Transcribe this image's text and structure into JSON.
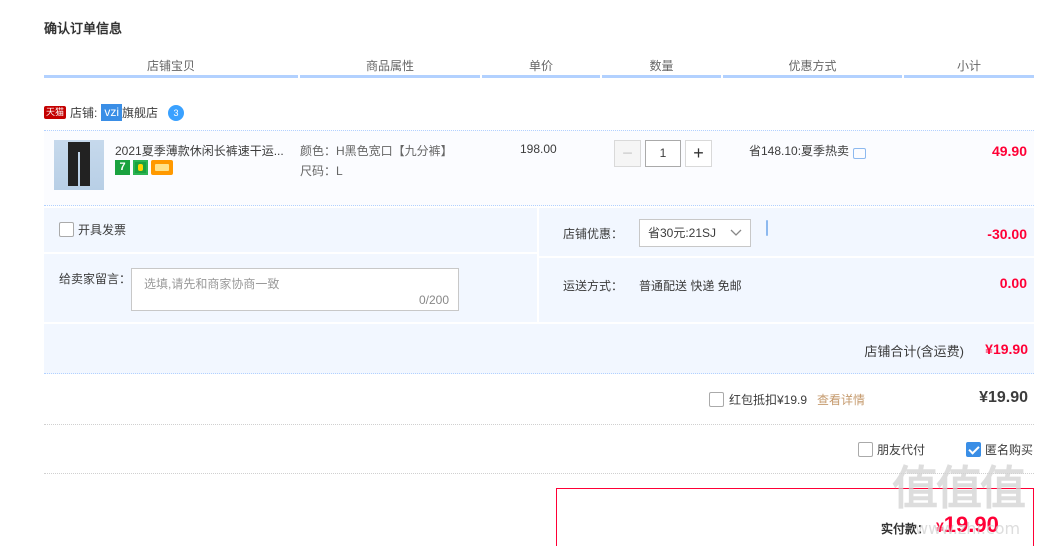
{
  "page": {
    "title": "确认订单信息"
  },
  "columns": [
    "店铺宝贝",
    "商品属性",
    "单价",
    "数量",
    "优惠方式",
    "小计"
  ],
  "shop": {
    "tmall_badge": "天猫",
    "label": "店铺:",
    "name_highlight": "vzi",
    "name_rest": "旗舰店",
    "wangwang": "3"
  },
  "item": {
    "name": "2021夏季薄款休闲长裤速干运...",
    "badge_seven": "7",
    "attr_color": "颜色：H黑色宽口【九分裤】",
    "attr_size": "尺码：L",
    "unit_price": "198.00",
    "quantity": "1",
    "minus": "−",
    "plus": "+",
    "promotion": "省148.10:夏季热卖",
    "subtotal": "49.90"
  },
  "invoice": {
    "label": "开具发票"
  },
  "message": {
    "label": "给卖家留言：",
    "placeholder": "选填,请先和商家协商一致",
    "counter": "0/200"
  },
  "shop_discount": {
    "label": "店铺优惠：",
    "selected": "省30元:21SJ",
    "amount": "-30.00"
  },
  "shipping": {
    "label": "运送方式：",
    "method": "普通配送 快递 免邮",
    "amount": "0.00"
  },
  "shop_total": {
    "label": "店铺合计(含运费)",
    "amount": "¥19.90"
  },
  "redpacket": {
    "label": "红包抵扣¥19.9",
    "link": "查看详情",
    "amount": "¥19.90"
  },
  "options": {
    "friend_pay": "朋友代付",
    "anonymous": "匿名购买"
  },
  "final": {
    "label": "实付款：",
    "currency": "¥",
    "amount": "19.90"
  },
  "watermark": {
    "logo": "值值值",
    "site": "www.zhi.com"
  }
}
